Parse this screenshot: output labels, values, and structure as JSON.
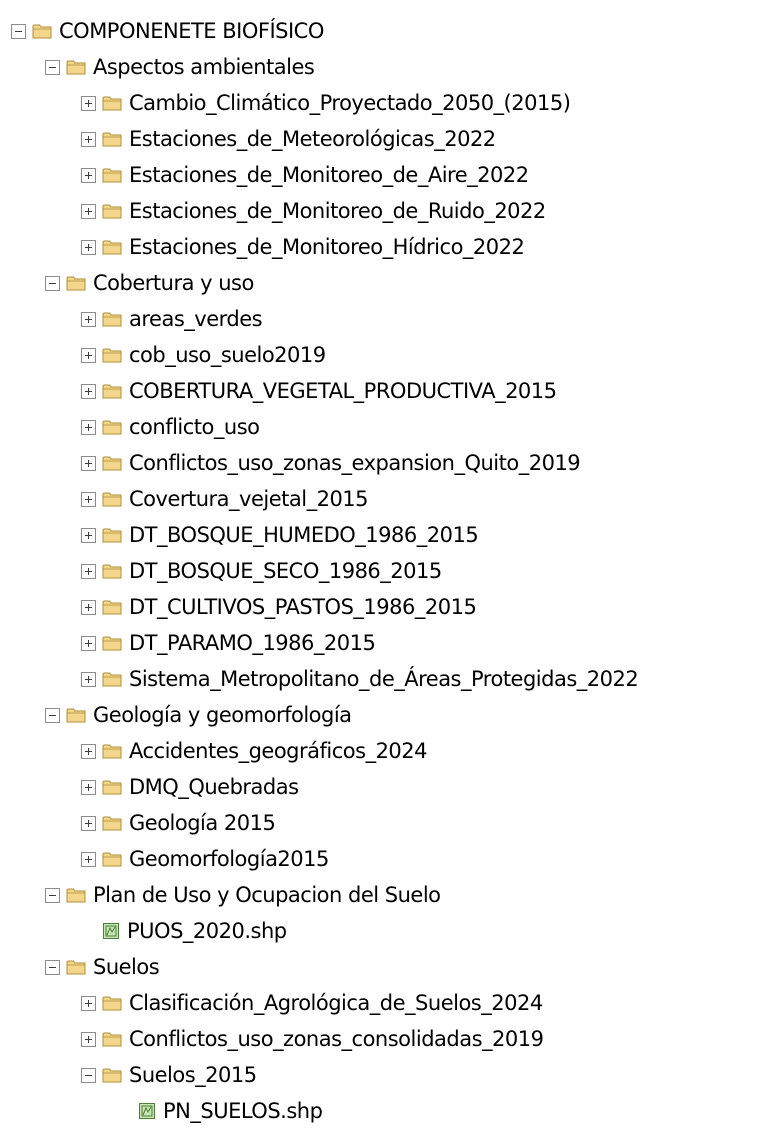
{
  "colors": {
    "folder_fill": "#f2d68c",
    "folder_stroke": "#b08d3a",
    "layer_fill": "#c8e6b4",
    "layer_stroke": "#4d7f3a"
  },
  "tree": [
    {
      "label": "COMPONENETE BIOFÍSICO",
      "level": 0,
      "state": "expanded",
      "icon": "folder-icon"
    },
    {
      "label": "Aspectos ambientales",
      "level": 1,
      "state": "expanded",
      "icon": "folder-icon"
    },
    {
      "label": "Cambio_Climático_Proyectado_2050_(2015)",
      "level": 2,
      "state": "collapsed",
      "icon": "folder-icon"
    },
    {
      "label": "Estaciones_de_Meteorológicas_2022",
      "level": 2,
      "state": "collapsed",
      "icon": "folder-icon"
    },
    {
      "label": "Estaciones_de_Monitoreo_de_Aire_2022",
      "level": 2,
      "state": "collapsed",
      "icon": "folder-icon"
    },
    {
      "label": "Estaciones_de_Monitoreo_de_Ruido_2022",
      "level": 2,
      "state": "collapsed",
      "icon": "folder-icon"
    },
    {
      "label": "Estaciones_de_Monitoreo_Hídrico_2022",
      "level": 2,
      "state": "collapsed",
      "icon": "folder-icon"
    },
    {
      "label": "Cobertura y uso",
      "level": 1,
      "state": "expanded",
      "icon": "folder-icon"
    },
    {
      "label": "areas_verdes",
      "level": 2,
      "state": "collapsed",
      "icon": "folder-icon"
    },
    {
      "label": "cob_uso_suelo2019",
      "level": 2,
      "state": "collapsed",
      "icon": "folder-icon"
    },
    {
      "label": "COBERTURA_VEGETAL_PRODUCTIVA_2015",
      "level": 2,
      "state": "collapsed",
      "icon": "folder-icon"
    },
    {
      "label": "conflicto_uso",
      "level": 2,
      "state": "collapsed",
      "icon": "folder-icon"
    },
    {
      "label": "Conflictos_uso_zonas_expansion_Quito_2019",
      "level": 2,
      "state": "collapsed",
      "icon": "folder-icon"
    },
    {
      "label": "Covertura_vejetal_2015",
      "level": 2,
      "state": "collapsed",
      "icon": "folder-icon"
    },
    {
      "label": "DT_BOSQUE_HUMEDO_1986_2015",
      "level": 2,
      "state": "collapsed",
      "icon": "folder-icon"
    },
    {
      "label": "DT_BOSQUE_SECO_1986_2015",
      "level": 2,
      "state": "collapsed",
      "icon": "folder-icon"
    },
    {
      "label": "DT_CULTIVOS_PASTOS_1986_2015",
      "level": 2,
      "state": "collapsed",
      "icon": "folder-icon"
    },
    {
      "label": "DT_PARAMO_1986_2015",
      "level": 2,
      "state": "collapsed",
      "icon": "folder-icon"
    },
    {
      "label": "Sistema_Metropolitano_de_Áreas_Protegidas_2022",
      "level": 2,
      "state": "collapsed",
      "icon": "folder-icon"
    },
    {
      "label": "Geología y geomorfología",
      "level": 1,
      "state": "expanded",
      "icon": "folder-icon"
    },
    {
      "label": "Accidentes_geográficos_2024",
      "level": 2,
      "state": "collapsed",
      "icon": "folder-icon"
    },
    {
      "label": "DMQ_Quebradas",
      "level": 2,
      "state": "collapsed",
      "icon": "folder-icon"
    },
    {
      "label": "Geología 2015",
      "level": 2,
      "state": "collapsed",
      "icon": "folder-icon"
    },
    {
      "label": "Geomorfología2015",
      "level": 2,
      "state": "collapsed",
      "icon": "folder-icon"
    },
    {
      "label": "Plan de Uso y Ocupacion del Suelo",
      "level": 1,
      "state": "expanded",
      "icon": "folder-icon"
    },
    {
      "label": "PUOS_2020.shp",
      "level": 2,
      "state": "leaf",
      "icon": "shapefile-icon"
    },
    {
      "label": "Suelos",
      "level": 1,
      "state": "expanded",
      "icon": "folder-icon"
    },
    {
      "label": "Clasificación_Agrológica_de_Suelos_2024",
      "level": 2,
      "state": "collapsed",
      "icon": "folder-icon"
    },
    {
      "label": "Conflictos_uso_zonas_consolidadas_2019",
      "level": 2,
      "state": "collapsed",
      "icon": "folder-icon"
    },
    {
      "label": "Suelos_2015",
      "level": 2,
      "state": "expanded",
      "icon": "folder-icon"
    },
    {
      "label": "PN_SUELOS.shp",
      "level": 3,
      "state": "leaf",
      "icon": "shapefile-icon"
    }
  ]
}
